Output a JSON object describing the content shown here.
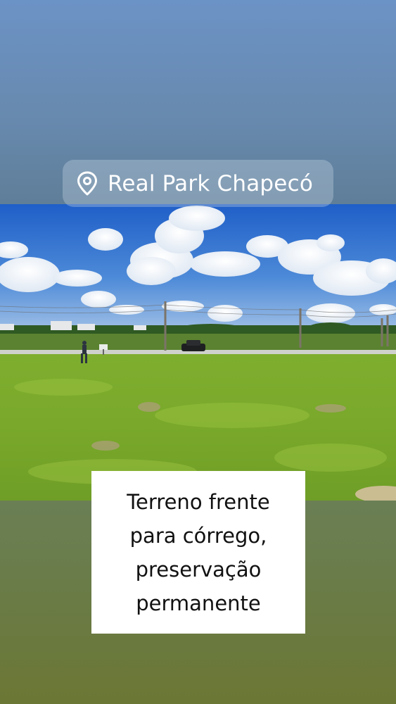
{
  "location_sticker": {
    "icon": "map-pin-icon",
    "label": "Real Park Chapecó"
  },
  "caption": {
    "lines": [
      "Terreno frente",
      "para córrego,",
      "preservação",
      "permanente"
    ]
  },
  "photo": {
    "scene": "grass-field-under-blue-sky"
  },
  "colors": {
    "sky_blue": "#2f6fd0",
    "grass_green": "#7aaa2c",
    "background_top": "#6c93c6",
    "background_bottom": "#6b7734",
    "caption_bg": "#ffffff"
  }
}
